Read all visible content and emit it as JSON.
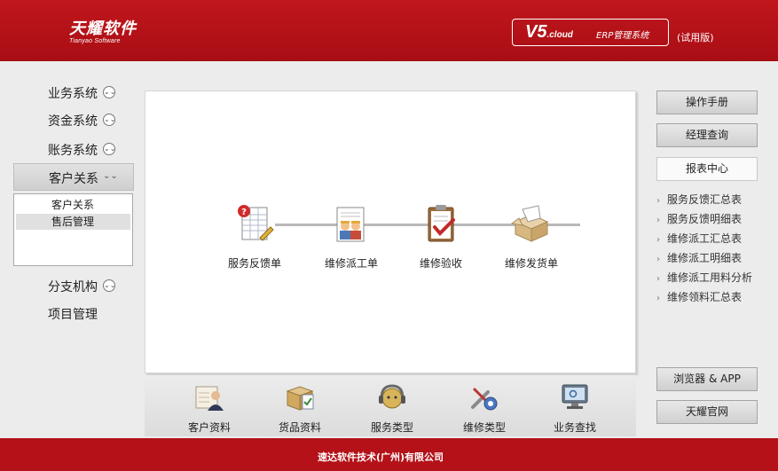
{
  "header": {
    "logo_cn": "天耀软件",
    "logo_en": "Tianyao Software",
    "version": "V5",
    "version_suffix": ".cloud",
    "product": "ERP管理系统",
    "trial": "(试用版)"
  },
  "nav": {
    "items": [
      {
        "label": "业务系统",
        "chevron": "⌄⌄"
      },
      {
        "label": "资金系统",
        "chevron": "⌄⌄"
      },
      {
        "label": "账务系统",
        "chevron": "⌄⌄"
      },
      {
        "label": "客户关系",
        "chevron": "⌄⌄"
      },
      {
        "label": "分支机构",
        "chevron": "⌄⌄"
      },
      {
        "label": "项目管理"
      }
    ],
    "sub_items": [
      {
        "label": "客户关系"
      },
      {
        "label": "售后管理"
      }
    ]
  },
  "flow": {
    "steps": [
      {
        "label": "服务反馈单",
        "icon": "feedback-form-icon"
      },
      {
        "label": "维修派工单",
        "icon": "dispatch-order-icon"
      },
      {
        "label": "维修验收",
        "icon": "acceptance-clipboard-icon"
      },
      {
        "label": "维修发货单",
        "icon": "shipping-box-icon"
      }
    ]
  },
  "bottom": {
    "items": [
      {
        "label": "客户资料",
        "icon": "customer-card-icon"
      },
      {
        "label": "货品资料",
        "icon": "goods-box-icon"
      },
      {
        "label": "服务类型",
        "icon": "headset-service-icon"
      },
      {
        "label": "维修类型",
        "icon": "tools-gear-icon"
      },
      {
        "label": "业务查找",
        "icon": "monitor-search-icon"
      }
    ]
  },
  "right": {
    "buttons": [
      {
        "label": "操作手册"
      },
      {
        "label": "经理查询"
      },
      {
        "label": "报表中心"
      }
    ],
    "reports": [
      {
        "label": "服务反馈汇总表"
      },
      {
        "label": "服务反馈明细表"
      },
      {
        "label": "维修派工汇总表"
      },
      {
        "label": "维修派工明细表"
      },
      {
        "label": "维修派工用料分析"
      },
      {
        "label": "维修领料汇总表"
      }
    ],
    "bottom_buttons": [
      {
        "label": "浏览器 & APP"
      },
      {
        "label": "天耀官网"
      }
    ]
  },
  "footer": {
    "company": "速达软件技术(广州)有限公司"
  },
  "colors": {
    "brand_red": "#b41118",
    "panel_bg": "#ececec"
  }
}
